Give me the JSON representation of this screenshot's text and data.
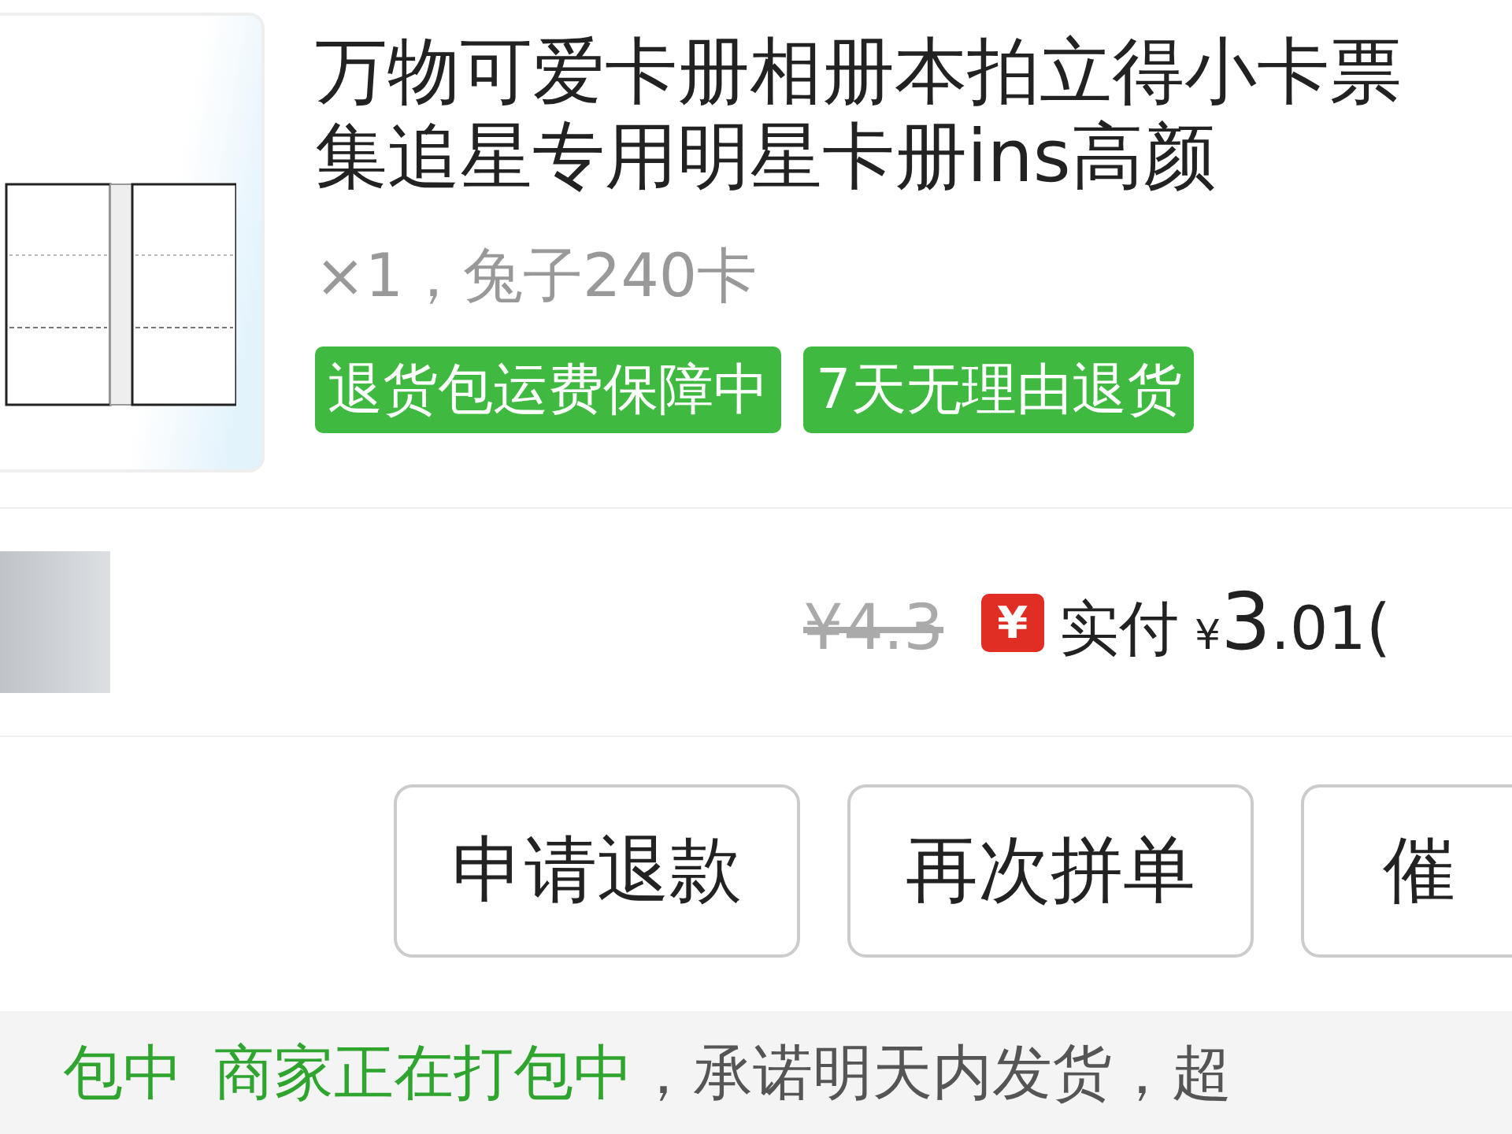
{
  "product": {
    "title_lines": [
      "万物可爱卡册相册本拍立得小卡票",
      "集追星专用明星卡册ins高颜"
    ],
    "spec": "×1，兔子240卡",
    "tags": [
      "退货包运费保障中",
      "7天无理由退货"
    ]
  },
  "price": {
    "original": "¥4.3",
    "coupon_icon": "¥",
    "paid_label": "实付",
    "currency": "¥",
    "paid_integer": "3",
    "paid_decimal": ".01",
    "note": "("
  },
  "buttons": [
    "申请退款",
    "再次拼单",
    "催"
  ],
  "status": {
    "state": "包中",
    "message": "商家正在打包中",
    "detail": "，承诺明天内发货，超"
  }
}
